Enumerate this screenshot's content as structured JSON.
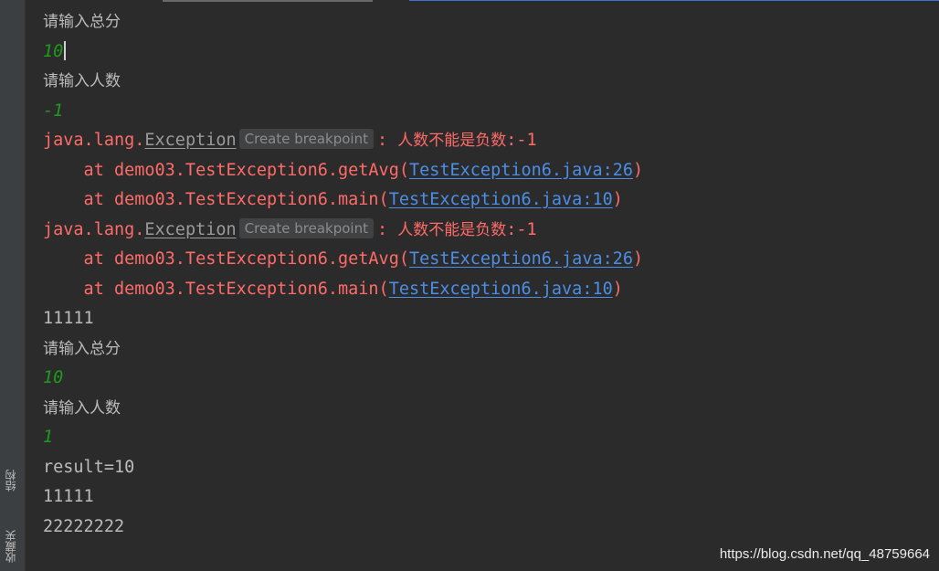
{
  "sidebar": {
    "tabs": [
      {
        "label": "结构"
      },
      {
        "label": "收藏夹"
      }
    ]
  },
  "console": {
    "prompt_total": "请输入总分",
    "prompt_count": "请输入人数",
    "input_total_1": "10",
    "input_count_1": "-1",
    "exception_pkg": "java.lang.",
    "exception_class": "Exception",
    "breakpoint_hint": "Create breakpoint",
    "exception_sep": ": ",
    "exception_msg": "人数不能是负数",
    "exception_val": ":-1",
    "trace_getavg_prefix": "    at demo03.TestException6.getAvg(",
    "trace_getavg_link": "TestException6.java:26",
    "trace_main_prefix": "    at demo03.TestException6.main(",
    "trace_main_link": "TestException6.java:10",
    "trace_suffix": ")",
    "out_11111": "11111",
    "input_total_2": "10",
    "input_count_2": "1",
    "result": "result=10",
    "out_2222": "22222222"
  },
  "watermark": "https://blog.csdn.net/qq_48759664"
}
